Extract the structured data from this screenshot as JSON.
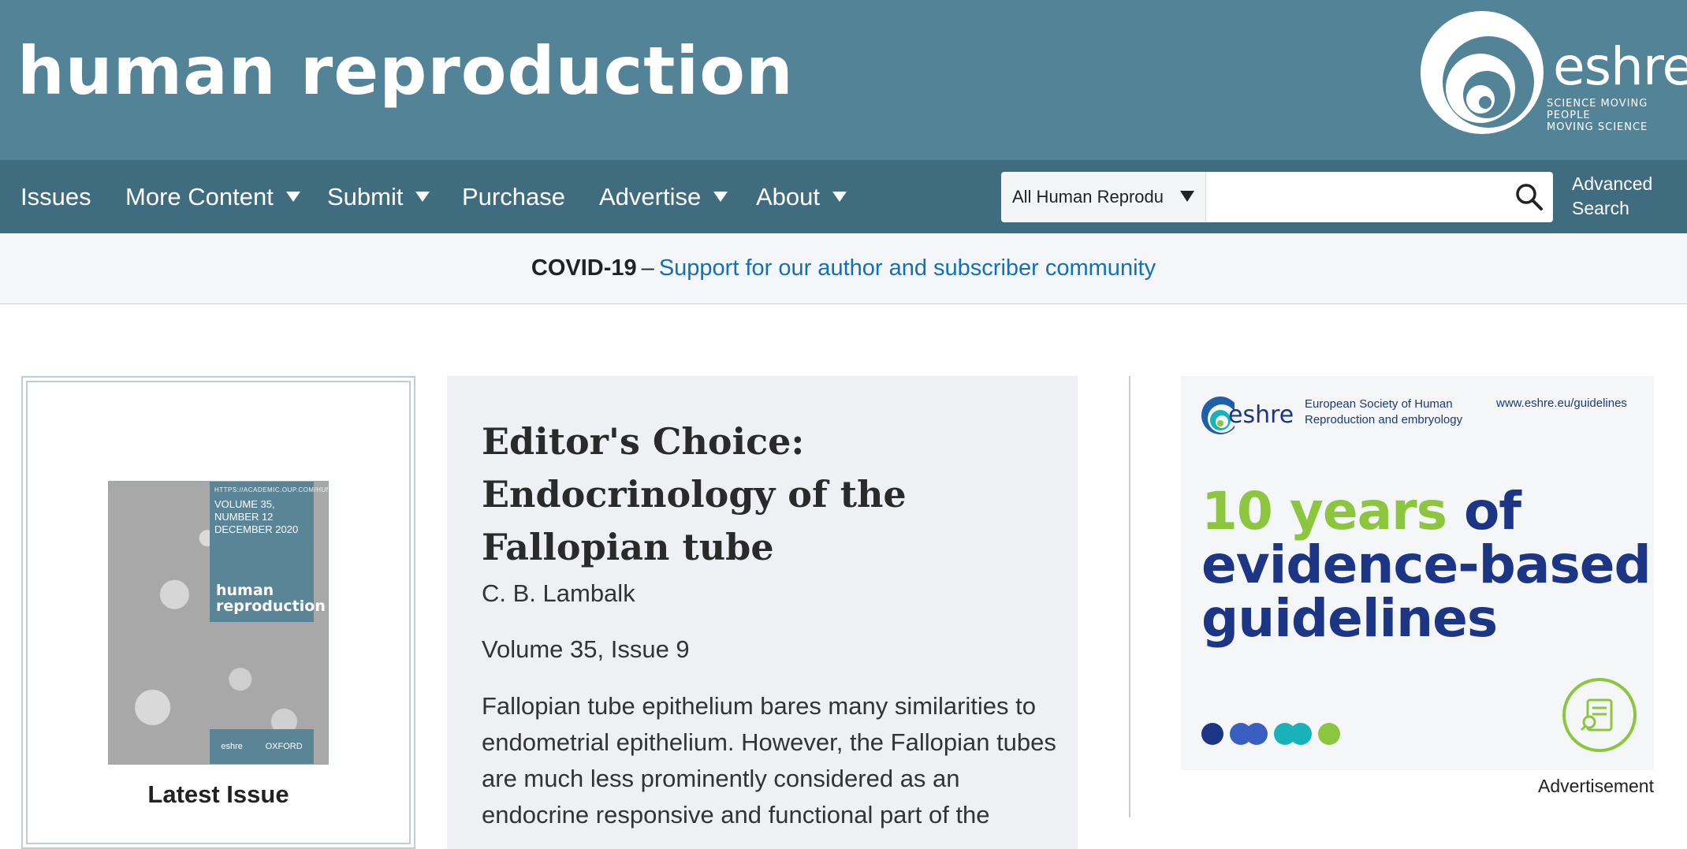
{
  "header": {
    "site_title": "human reproduction",
    "logo": {
      "word": "eshre",
      "tagline": [
        "SCIENCE MOVING",
        "PEOPLE",
        "MOVING SCIENCE"
      ]
    }
  },
  "nav": {
    "items": [
      {
        "label": "Issues",
        "has_dropdown": false
      },
      {
        "label": "More Content",
        "has_dropdown": true
      },
      {
        "label": "Submit",
        "has_dropdown": true
      },
      {
        "label": "Purchase",
        "has_dropdown": false
      },
      {
        "label": "Advertise",
        "has_dropdown": true
      },
      {
        "label": "About",
        "has_dropdown": true
      }
    ],
    "search": {
      "scope_selected": "All Human Reprodu",
      "value": "",
      "placeholder": "",
      "icon": "search-icon"
    },
    "advanced_search": [
      "Advanced",
      "Search"
    ]
  },
  "alert": {
    "prefix": "COVID-19",
    "separator": "–",
    "link_text": "Support for our author and subscriber community"
  },
  "latest_issue": {
    "cover": {
      "url": "HTTPS://ACADEMIC.OUP.COM/HUMREP",
      "volume_line": "VOLUME 35, NUMBER 12",
      "date_line": "DECEMBER 2020",
      "title_line1": "human",
      "title_line2": "reproduction",
      "footer_left": "eshre",
      "footer_right": "OXFORD"
    },
    "label": "Latest Issue"
  },
  "feature": {
    "title": "Editor's Choice: Endocrinology of the Fallopian tube",
    "author": "C. B. Lambalk",
    "volume": "Volume 35, Issue 9",
    "abstract": "Fallopian tube epithelium bares many similarities to endometrial epithelium. However, the Fallopian tubes are much less prominently considered as an endocrine responsive and functional part of the"
  },
  "ad": {
    "logo_word": "eshre",
    "org_line1": "European Society of Human",
    "org_line2": "Reproduction and embryology",
    "url": "www.eshre.eu/guidelines",
    "headline_green": "10 years",
    "headline_rest1": "of",
    "headline_line2": "evidence-based",
    "headline_line3": "guidelines",
    "colors": {
      "navy": "#1d3585",
      "green": "#8cc63f",
      "blue": "#3b5fc0",
      "teal": "#18b3b8"
    },
    "label": "Advertisement"
  },
  "colors": {
    "header_bg": "#538396",
    "nav_bg": "#3f6c7f",
    "link": "#1070b8"
  }
}
